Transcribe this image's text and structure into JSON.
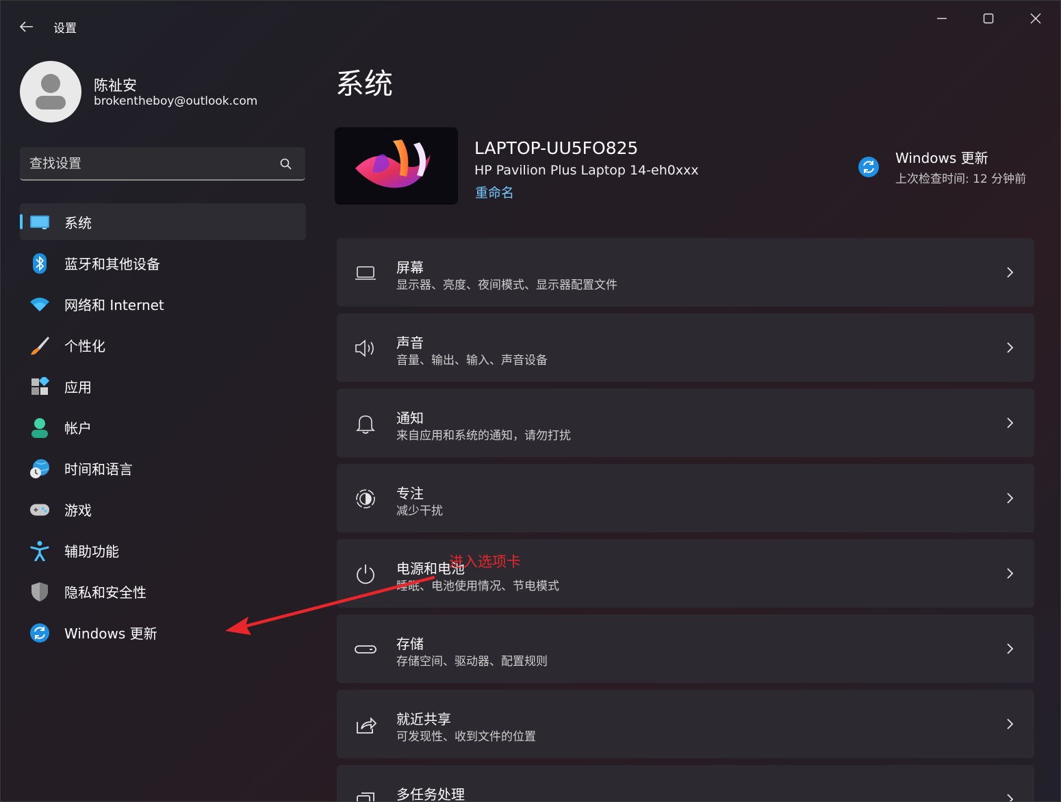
{
  "window": {
    "title": "设置"
  },
  "user": {
    "name": "陈祉安",
    "email": "brokentheboy@outlook.com"
  },
  "search": {
    "placeholder": "查找设置"
  },
  "nav": {
    "items": [
      {
        "label": "系统",
        "icon": "monitor-icon",
        "active": true
      },
      {
        "label": "蓝牙和其他设备",
        "icon": "bluetooth-icon"
      },
      {
        "label": "网络和 Internet",
        "icon": "wifi-icon"
      },
      {
        "label": "个性化",
        "icon": "paintbrush-icon"
      },
      {
        "label": "应用",
        "icon": "apps-icon"
      },
      {
        "label": "帐户",
        "icon": "person-icon"
      },
      {
        "label": "时间和语言",
        "icon": "globe-clock-icon"
      },
      {
        "label": "游戏",
        "icon": "gamepad-icon"
      },
      {
        "label": "辅助功能",
        "icon": "accessibility-icon"
      },
      {
        "label": "隐私和安全性",
        "icon": "shield-icon"
      },
      {
        "label": "Windows 更新",
        "icon": "sync-icon"
      }
    ]
  },
  "main": {
    "title": "系统",
    "device": {
      "name": "LAPTOP-UU5FO825",
      "model": "HP Pavilion Plus Laptop 14-eh0xxx",
      "rename": "重命名"
    },
    "update": {
      "title": "Windows 更新",
      "subtitle": "上次检查时间: 12 分钟前"
    },
    "cards": [
      {
        "title": "屏幕",
        "subtitle": "显示器、亮度、夜间模式、显示器配置文件",
        "icon": "laptop-icon"
      },
      {
        "title": "声音",
        "subtitle": "音量、输出、输入、声音设备",
        "icon": "speaker-icon"
      },
      {
        "title": "通知",
        "subtitle": "来自应用和系统的通知，请勿打扰",
        "icon": "bell-icon"
      },
      {
        "title": "专注",
        "subtitle": "减少干扰",
        "icon": "focus-icon"
      },
      {
        "title": "电源和电池",
        "subtitle": "睡眠、电池使用情况、节电模式",
        "icon": "power-icon"
      },
      {
        "title": "存储",
        "subtitle": "存储空间、驱动器、配置规则",
        "icon": "storage-icon"
      },
      {
        "title": "就近共享",
        "subtitle": "可发现性、收到文件的位置",
        "icon": "share-icon"
      },
      {
        "title": "多任务处理",
        "subtitle": "",
        "icon": "multitask-icon"
      }
    ]
  },
  "annotation": {
    "text": "进入选项卡",
    "color": "#e8262b"
  },
  "colors": {
    "accent": "#4cc2ff",
    "link": "#76c8ff"
  }
}
